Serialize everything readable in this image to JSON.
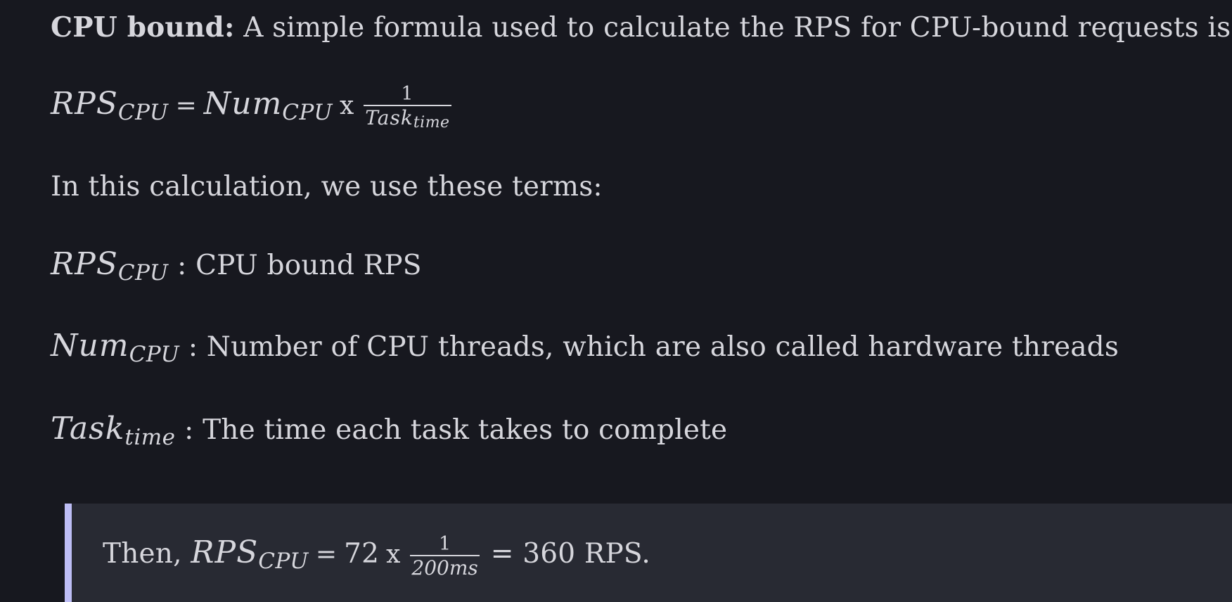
{
  "intro": {
    "bold": "CPU bound:",
    "text": " A simple formula used to calculate the RPS for CPU-bound requests is:"
  },
  "formula": {
    "lhs_main": "RPS",
    "lhs_sub": "CPU",
    "equals": "=",
    "num_main": "Num",
    "num_sub": "CPU",
    "times": "x",
    "frac_num": "1",
    "frac_den_main": "Task",
    "frac_den_sub": "time"
  },
  "terms_intro": "In this calculation, we use these terms:",
  "terms": [
    {
      "main": "RPS",
      "sub": "CPU",
      "desc": " : CPU bound RPS"
    },
    {
      "main": "Num",
      "sub": "CPU",
      "desc": " : Number of CPU threads, which are also called hardware threads"
    },
    {
      "main": "Task",
      "sub": "time",
      "desc": " : The time each task takes to complete"
    }
  ],
  "callout": {
    "prefix": "Then, ",
    "lhs_main": "RPS",
    "lhs_sub": "CPU",
    "equals": "=",
    "value": "72",
    "times": "x",
    "frac_num": "1",
    "frac_den": "200ms",
    "result": "= 360 RPS."
  },
  "colors": {
    "background": "#17181f",
    "text": "#d6d6dc",
    "callout_background": "#282a33",
    "callout_accent": "#bdbdf5"
  }
}
